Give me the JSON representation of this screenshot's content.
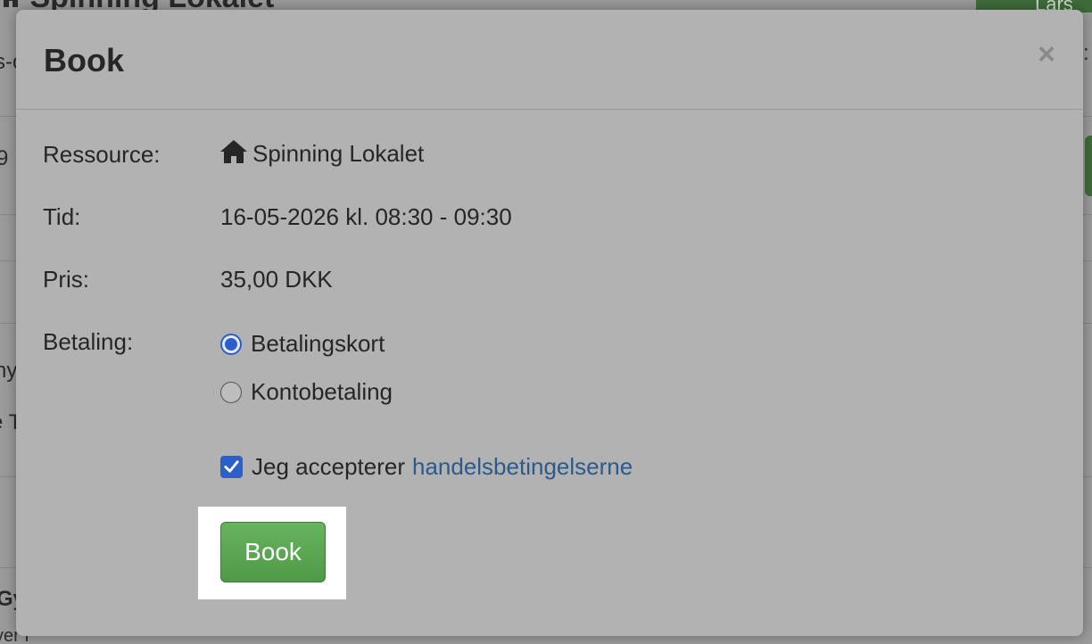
{
  "background": {
    "page_title": "Spinning Lokalet",
    "fragments": [
      "s-c",
      "9",
      "ny",
      "e T",
      "Gy",
      "ver f",
      "Lars",
      ":"
    ]
  },
  "modal": {
    "title": "Book",
    "close_label": "×",
    "resource": {
      "label": "Ressource:",
      "icon": "home-icon",
      "value": "Spinning Lokalet"
    },
    "time": {
      "label": "Tid:",
      "value": "16-05-2026 kl. 08:30 - 09:30"
    },
    "price": {
      "label": "Pris:",
      "value": "35,00 DKK"
    },
    "payment": {
      "label": "Betaling:",
      "options": [
        {
          "label": "Betalingskort",
          "selected": true
        },
        {
          "label": "Kontobetaling",
          "selected": false
        }
      ]
    },
    "terms": {
      "text": "Jeg accepterer",
      "link": "handelsbetingelserne",
      "checked": true
    },
    "book_button": "Book"
  },
  "colors": {
    "accent_blue": "#2a5fcc",
    "button_green": "#5aa651",
    "link_blue": "#2c5a8c"
  }
}
